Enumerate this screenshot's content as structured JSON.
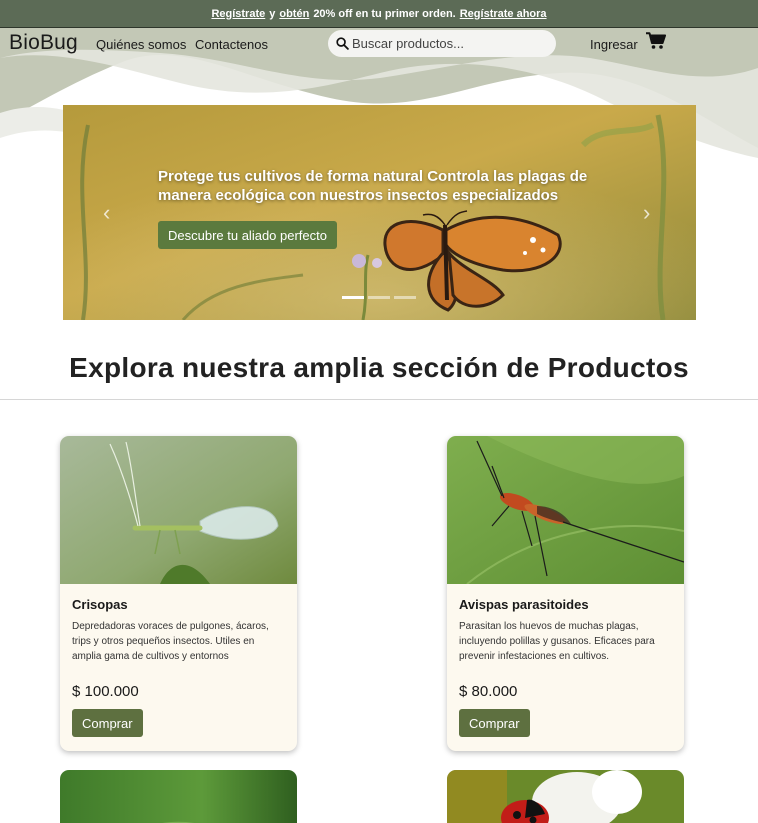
{
  "promo": {
    "link1": "Regístrate",
    "mid1": "y",
    "link2": "obtén",
    "mid2": "20% off en tu primer orden.",
    "link3": "Regístrate ahora"
  },
  "nav": {
    "brand": "BioBug",
    "links": [
      "Quiénes somos",
      "Contactenos"
    ],
    "search_placeholder": "Buscar productos...",
    "login": "Ingresar"
  },
  "hero": {
    "title": "Protege tus cultivos de forma natural Controla las plagas de manera ecológica con nuestros insectos especializados",
    "button": "Descubre tu aliado perfecto",
    "prev": "‹",
    "next": "›",
    "slides": 3,
    "active_slide": 1
  },
  "section_title": "Explora nuestra amplia sección de Productos",
  "products": [
    {
      "name": "Crisopas",
      "description": "Depredadoras voraces de pulgones, ácaros, trips y otros pequeños insectos. Utiles en amplia gama de cultivos y entornos",
      "price": "$ 100.000",
      "button": "Comprar"
    },
    {
      "name": "Avispas parasitoides",
      "description": "Parasitan los huevos de muchas plagas, incluyendo polillas y gusanos. Eficaces para prevenir infestaciones en cultivos.",
      "price": "$ 80.000",
      "button": "Comprar"
    }
  ],
  "colors": {
    "promo_bg": "#5c6b56",
    "accent_green": "#5e7040",
    "card_bg": "#fdf9ef"
  },
  "icons": [
    "search-icon",
    "cart-icon",
    "chevron-left-icon",
    "chevron-right-icon"
  ]
}
